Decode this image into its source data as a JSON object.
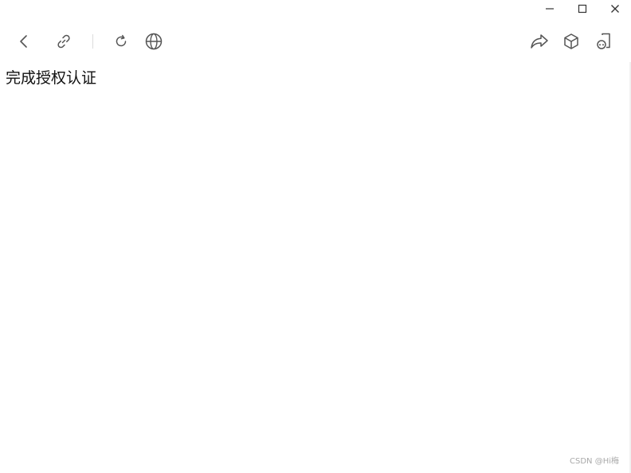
{
  "window_controls": {
    "minimize_icon": "minimize-icon",
    "maximize_icon": "maximize-icon",
    "close_icon": "close-icon"
  },
  "toolbar": {
    "icons": [
      "back-icon",
      "link-icon",
      "refresh-icon",
      "globe-icon",
      "share-icon",
      "cube-icon",
      "mini-program-icon"
    ],
    "icon_color": "#555555"
  },
  "page": {
    "message": "完成授权认证"
  },
  "watermark": {
    "text": "CSDN @Hi梅"
  }
}
